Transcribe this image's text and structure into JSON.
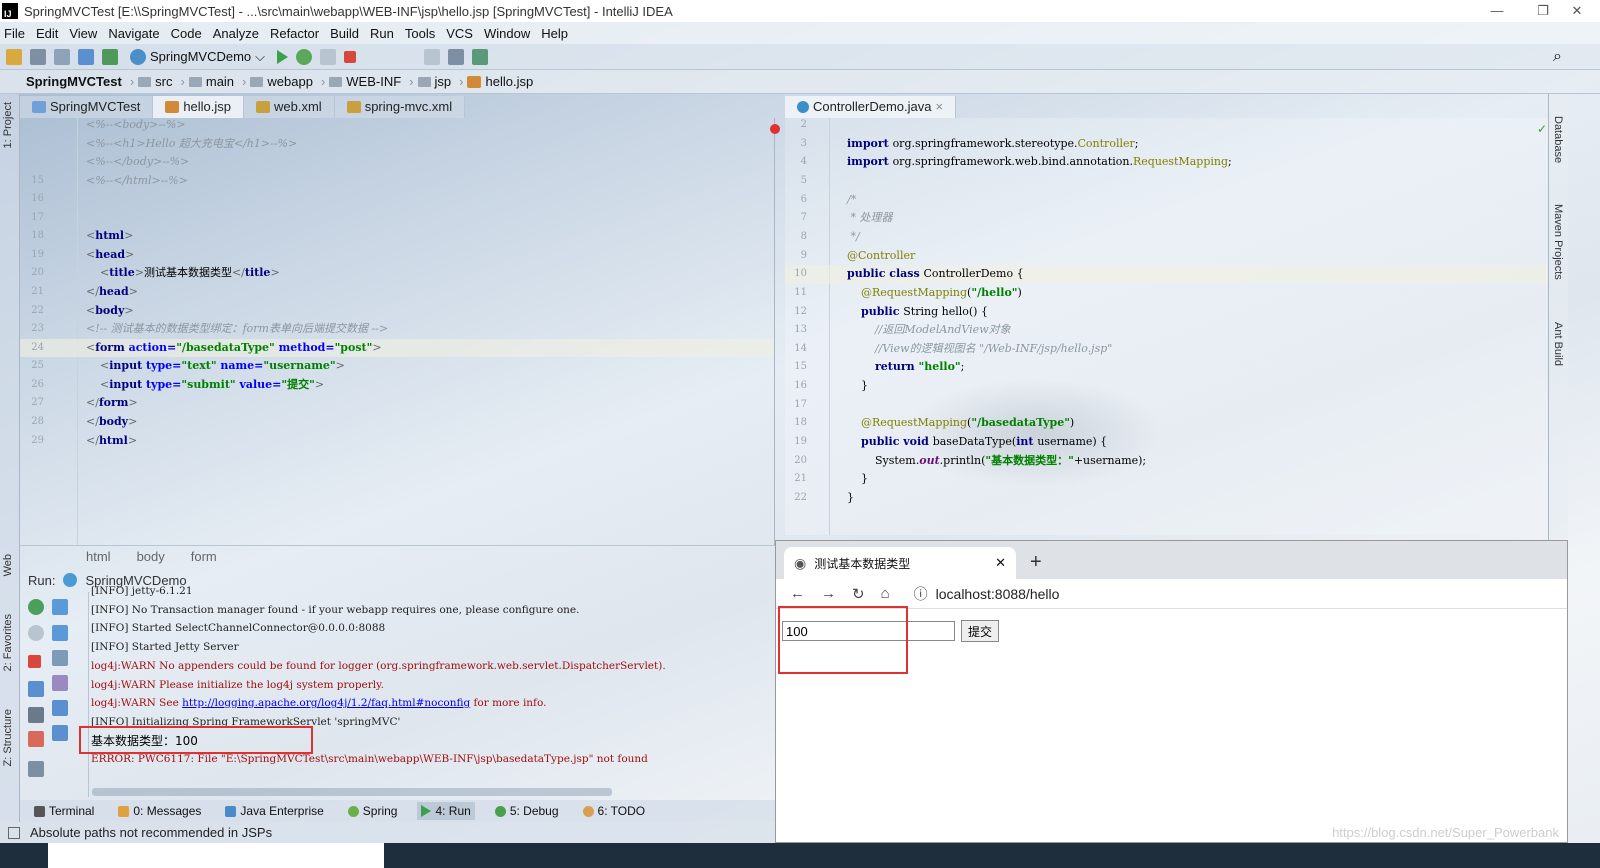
{
  "window": {
    "title": "SpringMVCTest [E:\\\\SpringMVCTest] - ...\\src\\main\\webapp\\WEB-INF\\jsp\\hello.jsp [SpringMVCTest] - IntelliJ IDEA",
    "logo": "IJ",
    "minimize": "—",
    "restore": "❐",
    "close": "✕"
  },
  "menu": [
    "File",
    "Edit",
    "View",
    "Navigate",
    "Code",
    "Analyze",
    "Refactor",
    "Build",
    "Run",
    "Tools",
    "VCS",
    "Window",
    "Help"
  ],
  "toolbar": {
    "run_config": "SpringMVCDemo",
    "dropdown": "⌵",
    "search": "⌕"
  },
  "breadcrumb": [
    "SpringMVCTest",
    "src",
    "main",
    "webapp",
    "WEB-INF",
    "jsp",
    "hello.jsp"
  ],
  "left_strip": {
    "project": "1: Project",
    "web": "Web",
    "favorites": "2: Favorites",
    "structure": "Z: Structure"
  },
  "right_strip": {
    "database": "Database",
    "maven": "Maven Projects",
    "ant": "Ant Build"
  },
  "left_editor": {
    "tabs": [
      "SpringMVCTest",
      "hello.jsp",
      "web.xml",
      "spring-mvc.xml"
    ],
    "active_tab": 1,
    "lines": [
      {
        "n": "",
        "t": [
          [
            "cm",
            "<%--<body>--%>"
          ]
        ]
      },
      {
        "n": "",
        "t": [
          [
            "cm",
            "<%--<h1>Hello 超大充电宝</h1>--%>"
          ]
        ]
      },
      {
        "n": "",
        "t": [
          [
            "cm",
            "<%--</body>--%>"
          ]
        ]
      },
      {
        "n": "15",
        "t": [
          [
            "cm",
            "<%--</html>--%>"
          ]
        ]
      },
      {
        "n": "16",
        "t": []
      },
      {
        "n": "17",
        "t": []
      },
      {
        "n": "18",
        "t": [
          [
            "br",
            "<"
          ],
          [
            "tag",
            "html"
          ],
          [
            "br",
            ">"
          ]
        ]
      },
      {
        "n": "19",
        "t": [
          [
            "br",
            "<"
          ],
          [
            "tag",
            "head"
          ],
          [
            "br",
            ">"
          ]
        ]
      },
      {
        "n": "20",
        "t": [
          [
            "pl",
            "    "
          ],
          [
            "br",
            "<"
          ],
          [
            "tag",
            "title"
          ],
          [
            "br",
            ">"
          ],
          [
            "cn",
            "测试基本数据类型"
          ],
          [
            "br",
            "</"
          ],
          [
            "tag",
            "title"
          ],
          [
            "br",
            ">"
          ]
        ]
      },
      {
        "n": "21",
        "t": [
          [
            "br",
            "</"
          ],
          [
            "tag",
            "head"
          ],
          [
            "br",
            ">"
          ]
        ]
      },
      {
        "n": "22",
        "t": [
          [
            "br",
            "<"
          ],
          [
            "tag",
            "body"
          ],
          [
            "br",
            ">"
          ]
        ]
      },
      {
        "n": "23",
        "t": [
          [
            "cm",
            "<!-- 测试基本的数据类型绑定：form表单向后端提交数据 -->"
          ]
        ]
      },
      {
        "n": "24",
        "t": [
          [
            "br",
            "<"
          ],
          [
            "tag",
            "form "
          ],
          [
            "attr",
            "action="
          ],
          [
            "str",
            "\"/basedataType\" "
          ],
          [
            "attr",
            "method="
          ],
          [
            "str",
            "\"post\""
          ],
          [
            "br",
            ">"
          ]
        ]
      },
      {
        "n": "25",
        "t": [
          [
            "pl",
            "    "
          ],
          [
            "br",
            "<"
          ],
          [
            "tag",
            "input "
          ],
          [
            "attr",
            "type="
          ],
          [
            "str",
            "\"text\" "
          ],
          [
            "attr",
            "name="
          ],
          [
            "str",
            "\"username\""
          ],
          [
            "br",
            ">"
          ]
        ]
      },
      {
        "n": "26",
        "t": [
          [
            "pl",
            "    "
          ],
          [
            "br",
            "<"
          ],
          [
            "tag",
            "input "
          ],
          [
            "attr",
            "type="
          ],
          [
            "str",
            "\"submit\" "
          ],
          [
            "attr",
            "value="
          ],
          [
            "str",
            "\"提交\""
          ],
          [
            "br",
            ">"
          ]
        ]
      },
      {
        "n": "27",
        "t": [
          [
            "br",
            "</"
          ],
          [
            "tag",
            "form"
          ],
          [
            "br",
            ">"
          ]
        ]
      },
      {
        "n": "28",
        "t": [
          [
            "br",
            "</"
          ],
          [
            "tag",
            "body"
          ],
          [
            "br",
            ">"
          ]
        ]
      },
      {
        "n": "29",
        "t": [
          [
            "br",
            "</"
          ],
          [
            "tag",
            "html"
          ],
          [
            "br",
            ">"
          ]
        ]
      }
    ],
    "path": [
      "html",
      "body",
      "form"
    ]
  },
  "right_editor": {
    "tabs": [
      "ControllerDemo.java"
    ],
    "close": "×",
    "lines": [
      {
        "n": "2",
        "t": []
      },
      {
        "n": "3",
        "t": [
          [
            "kw",
            "import "
          ],
          [
            "pl",
            "org.springframework.stereotype."
          ],
          [
            "cls",
            "Controller"
          ],
          [
            "pl",
            ";"
          ]
        ]
      },
      {
        "n": "4",
        "t": [
          [
            "kw",
            "import "
          ],
          [
            "pl",
            "org.springframework.web.bind.annotation."
          ],
          [
            "cls",
            "RequestMapping"
          ],
          [
            "pl",
            ";"
          ]
        ]
      },
      {
        "n": "5",
        "t": []
      },
      {
        "n": "6",
        "t": [
          [
            "cm",
            "/*"
          ]
        ]
      },
      {
        "n": "7",
        "t": [
          [
            "cm",
            " * 处理器"
          ]
        ]
      },
      {
        "n": "8",
        "t": [
          [
            "cm",
            " */"
          ]
        ]
      },
      {
        "n": "9",
        "t": [
          [
            "ann",
            "@Controller"
          ]
        ]
      },
      {
        "n": "10",
        "t": [
          [
            "kw",
            "public class "
          ],
          [
            "pl",
            "ControllerDemo {"
          ]
        ]
      },
      {
        "n": "11",
        "t": [
          [
            "pl",
            "    "
          ],
          [
            "ann",
            "@RequestMapping"
          ],
          [
            "pl",
            "("
          ],
          [
            "str",
            "\"/hello\""
          ],
          [
            "pl",
            ")"
          ]
        ]
      },
      {
        "n": "12",
        "t": [
          [
            "pl",
            "    "
          ],
          [
            "kw",
            "public "
          ],
          [
            "pl",
            "String hello() {"
          ]
        ]
      },
      {
        "n": "13",
        "t": [
          [
            "cm",
            "        //返回ModelAndView对象"
          ]
        ]
      },
      {
        "n": "14",
        "t": [
          [
            "cm",
            "        //View的逻辑视图名 \"/Web-INF/jsp/hello.jsp\""
          ]
        ]
      },
      {
        "n": "15",
        "t": [
          [
            "pl",
            "        "
          ],
          [
            "kw",
            "return "
          ],
          [
            "str",
            "\"hello\""
          ],
          [
            "pl",
            ";"
          ]
        ]
      },
      {
        "n": "16",
        "t": [
          [
            "pl",
            "    }"
          ]
        ]
      },
      {
        "n": "17",
        "t": []
      },
      {
        "n": "18",
        "t": [
          [
            "pl",
            "    "
          ],
          [
            "ann",
            "@RequestMapping"
          ],
          [
            "pl",
            "("
          ],
          [
            "str",
            "\"/basedataType\""
          ],
          [
            "pl",
            ")"
          ]
        ]
      },
      {
        "n": "19",
        "t": [
          [
            "pl",
            "    "
          ],
          [
            "kw",
            "public void "
          ],
          [
            "pl",
            "baseDataType("
          ],
          [
            "kw",
            "int "
          ],
          [
            "pl",
            "username) {"
          ]
        ]
      },
      {
        "n": "20",
        "t": [
          [
            "pl",
            "        System."
          ],
          [
            "fld",
            "out"
          ],
          [
            "pl",
            ".println("
          ],
          [
            "str",
            "\"基本数据类型：\""
          ],
          [
            "pl",
            "+username);"
          ]
        ]
      },
      {
        "n": "21",
        "t": [
          [
            "pl",
            "    }"
          ]
        ]
      },
      {
        "n": "22",
        "t": [
          [
            "pl",
            "}"
          ]
        ]
      }
    ]
  },
  "run": {
    "label": "Run:",
    "config": "SpringMVCDemo",
    "lines": [
      [
        "info",
        "[INFO] jetty-6.1.21"
      ],
      [
        "info",
        "[INFO] No Transaction manager found - if your webapp requires one, please configure one."
      ],
      [
        "info",
        "[INFO] Started SelectChannelConnector@0.0.0.0:8088"
      ],
      [
        "info",
        "[INFO] Started Jetty Server"
      ],
      [
        "warn",
        "log4j:WARN No appenders could be found for logger (org.springframework.web.servlet.DispatcherServlet)."
      ],
      [
        "warn",
        "log4j:WARN Please initialize the log4j system properly."
      ],
      [
        "warn",
        "log4j:WARN See "
      ],
      [
        "info",
        "[INFO] Initializing Spring FrameworkServlet 'springMVC'"
      ],
      [
        "cn",
        "基本数据类型：100"
      ],
      [
        "warn",
        "ERROR: PWC6117: File \"E:\\SpringMVCTest\\src\\main\\webapp\\WEB-INF\\jsp\\basedataType.jsp\" not found"
      ]
    ],
    "link": "http://logging.apache.org/log4j/1.2/faq.html#noconfig",
    "link_suffix": " for more info."
  },
  "bottom_tabs": [
    "Terminal",
    "0: Messages",
    "Java Enterprise",
    "Spring",
    "4: Run",
    "5: Debug",
    "6: TODO"
  ],
  "active_bottom_tab": 4,
  "status": "Absolute paths not recommended in JSPs",
  "browser": {
    "tab_title": "测试基本数据类型",
    "tab_close": "✕",
    "new_tab": "+",
    "back": "←",
    "forward": "→",
    "reload": "↻",
    "home": "⌂",
    "info": "ⓘ",
    "url": "localhost:8088/hello",
    "input_value": "100",
    "submit_label": "提交"
  },
  "watermark": "https://blog.csdn.net/Super_Powerbank",
  "colors": {
    "highlight_box": "#e03030",
    "keyword": "#000080",
    "string": "#008000",
    "warn": "#a01010"
  }
}
